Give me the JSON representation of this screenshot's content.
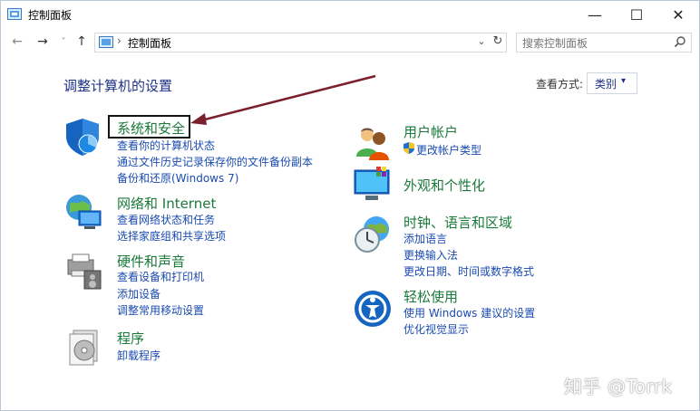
{
  "window": {
    "title": "控制面板",
    "minimize": "—",
    "maximize": "☐",
    "close": "✕"
  },
  "nav": {
    "back": "←",
    "forward": "→",
    "recent": "˅",
    "up": "↑",
    "address_sep": "›",
    "address": "控制面板",
    "dropdown": "⌄",
    "refresh": "↻",
    "search_placeholder": "搜索控制面板"
  },
  "page": {
    "title": "调整计算机的设置",
    "viewby_label": "查看方式:",
    "viewby_value": "类别",
    "viewby_caret": "▾"
  },
  "categories": [
    {
      "title": "系统和安全",
      "links": [
        "查看你的计算机状态",
        "通过文件历史记录保存你的文件备份副本",
        "备份和还原(Windows 7)"
      ],
      "icon": "shield-icon"
    },
    {
      "title": "网络和 Internet",
      "links": [
        "查看网络状态和任务",
        "选择家庭组和共享选项"
      ],
      "icon": "network-globe-icon"
    },
    {
      "title": "硬件和声音",
      "links": [
        "查看设备和打印机",
        "添加设备",
        "调整常用移动设置"
      ],
      "icon": "printer-speaker-icon"
    },
    {
      "title": "程序",
      "links": [
        "卸载程序"
      ],
      "icon": "programs-disc-icon"
    },
    {
      "title": "用户帐户",
      "links": [
        "更改帐户类型"
      ],
      "icon": "users-icon"
    },
    {
      "title": "外观和个性化",
      "links": [],
      "icon": "monitor-palette-icon"
    },
    {
      "title": "时钟、语言和区域",
      "links": [
        "添加语言",
        "更换输入法",
        "更改日期、时间或数字格式"
      ],
      "icon": "clock-globe-icon"
    },
    {
      "title": "轻松使用",
      "links": [
        "使用 Windows 建议的设置",
        "优化视觉显示"
      ],
      "icon": "ease-of-access-icon"
    }
  ],
  "colors": {
    "title_blue": "#1e3287",
    "category_green": "#1a7a3a",
    "link_blue": "#1a4bb0",
    "annotation_arrow": "#7a1f2b"
  },
  "watermark": "知乎 @Torrk"
}
